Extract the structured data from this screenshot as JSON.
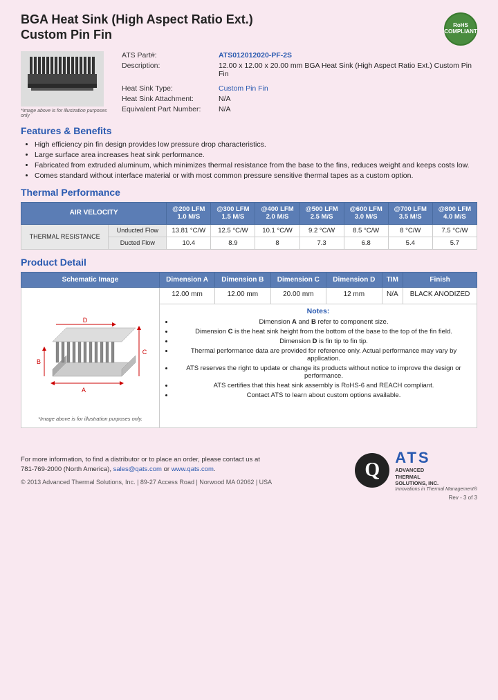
{
  "page": {
    "title_line1": "BGA Heat Sink (High Aspect Ratio Ext.)",
    "title_line2": "Custom Pin Fin"
  },
  "rohs": {
    "label": "RoHS\nCOMPLIANT"
  },
  "product": {
    "part_number_label": "ATS Part#:",
    "part_number_value": "ATS012012020-PF-2S",
    "description_label": "Description:",
    "description_value": "12.00 x 12.00 x 20.00 mm BGA Heat Sink (High Aspect Ratio Ext.) Custom Pin Fin",
    "heat_sink_type_label": "Heat Sink Type:",
    "heat_sink_type_value": "Custom Pin Fin",
    "heat_sink_attachment_label": "Heat Sink Attachment:",
    "heat_sink_attachment_value": "N/A",
    "equivalent_part_label": "Equivalent Part Number:",
    "equivalent_part_value": "N/A"
  },
  "image_caption": "*Image above is for illustration purposes only",
  "features": {
    "section_title": "Features & Benefits",
    "items": [
      "High efficiency pin fin design provides low pressure drop characteristics.",
      "Large surface area increases heat sink performance.",
      "Fabricated from extruded aluminum, which minimizes thermal resistance from the base to the fins, reduces weight and keeps costs low.",
      "Comes standard without interface material or with most common pressure sensitive thermal tapes as a custom option."
    ]
  },
  "thermal_performance": {
    "section_title": "Thermal Performance",
    "table": {
      "header_air_velocity": "AIR VELOCITY",
      "columns": [
        {
          "line1": "@200 LFM",
          "line2": "1.0 M/S"
        },
        {
          "line1": "@300 LFM",
          "line2": "1.5 M/S"
        },
        {
          "line1": "@400 LFM",
          "line2": "2.0 M/S"
        },
        {
          "line1": "@500 LFM",
          "line2": "2.5 M/S"
        },
        {
          "line1": "@600 LFM",
          "line2": "3.0 M/S"
        },
        {
          "line1": "@700 LFM",
          "line2": "3.5 M/S"
        },
        {
          "line1": "@800 LFM",
          "line2": "4.0 M/S"
        }
      ],
      "row_label": "THERMAL RESISTANCE",
      "rows": [
        {
          "label": "Unducted Flow",
          "values": [
            "13.81 °C/W",
            "12.5 °C/W",
            "10.1 °C/W",
            "9.2 °C/W",
            "8.5 °C/W",
            "8 °C/W",
            "7.5 °C/W"
          ]
        },
        {
          "label": "Ducted Flow",
          "values": [
            "10.4",
            "8.9",
            "8",
            "7.3",
            "6.8",
            "5.4",
            "5.7"
          ]
        }
      ]
    }
  },
  "product_detail": {
    "section_title": "Product Detail",
    "table": {
      "headers": [
        "Schematic Image",
        "Dimension A",
        "Dimension B",
        "Dimension C",
        "Dimension D",
        "TIM",
        "Finish"
      ],
      "dim_values": [
        "12.00 mm",
        "12.00 mm",
        "20.00 mm",
        "12 mm",
        "N/A",
        "BLACK ANODIZED"
      ]
    },
    "schematic_caption": "*Image above is for illustration purposes only.",
    "notes": {
      "title": "Notes:",
      "items": [
        "Dimension A and B refer to component size.",
        "Dimension C is the heat sink height from the bottom of the base to the top of the fin field.",
        "Dimension D is fin tip to fin tip.",
        "Thermal performance data are provided for reference only. Actual performance may vary by application.",
        "ATS reserves the right to update or change its products without notice to improve the design or performance.",
        "ATS certifies that this heat sink assembly is RoHS-6 and REACH compliant.",
        "Contact ATS to learn about custom options available."
      ],
      "bold_parts": [
        "A",
        "B",
        "C",
        "D"
      ]
    }
  },
  "footer": {
    "contact_text": "For more information, to find a distributor or to place an order, please contact us at",
    "phone": "781-769-2000 (North America)",
    "email": "sales@qats.com",
    "website": "www.qats.com",
    "copyright": "© 2013 Advanced Thermal Solutions, Inc.  |  89-27 Access Road  |  Norwood MA  02062  |  USA",
    "ats_big": "ATS",
    "ats_name": "ADVANCED\nTHERMAL\nSOLUTIONS, INC.",
    "ats_tagline": "Innovations in Thermal Management®",
    "rev": "Rev - 3 of 3"
  }
}
